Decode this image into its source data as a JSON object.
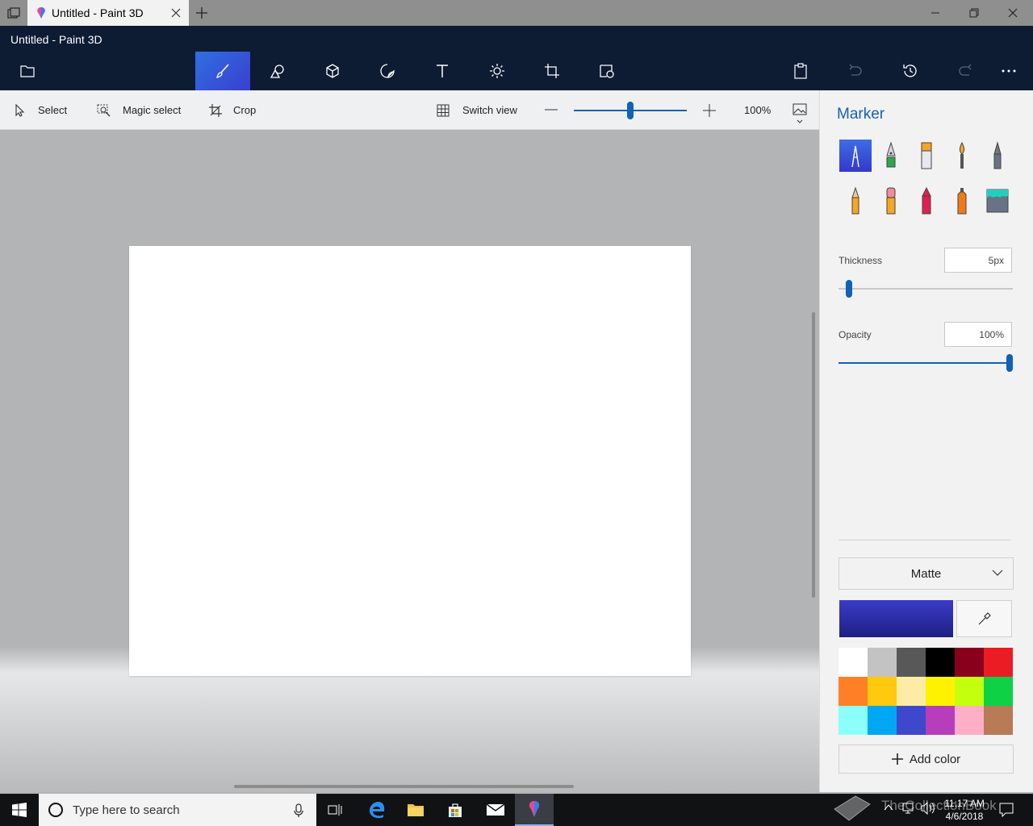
{
  "tab": {
    "title": "Untitled - Paint 3D"
  },
  "window": {
    "title": "Untitled - Paint 3D"
  },
  "appbar": {
    "tools": [
      "brushes-icon",
      "2d-shapes-icon",
      "3d-shapes-icon",
      "stickers-icon",
      "text-icon",
      "effects-icon",
      "canvas-icon",
      "3d-library-icon"
    ],
    "active_tool": "brushes-icon"
  },
  "toolbar": {
    "select": "Select",
    "magic_select": "Magic select",
    "crop": "Crop",
    "switch_view": "Switch view",
    "zoom": "100%",
    "zoom_level": 0.5
  },
  "panel": {
    "title": "Marker",
    "brushes": [
      "marker",
      "calligraphy-pen",
      "oil-brush",
      "watercolor",
      "pixel-pen",
      "pencil",
      "eraser",
      "crayon",
      "spray-can",
      "fill"
    ],
    "selected_brush": "marker",
    "thickness_label": "Thickness",
    "thickness_value": "5px",
    "thickness_level": 0.05,
    "opacity_label": "Opacity",
    "opacity_value": "100%",
    "opacity_level": 1.0,
    "finish": "Matte",
    "current_color": "#3a3cc8",
    "palette": [
      "#ffffff",
      "#c3c3c3",
      "#585858",
      "#000000",
      "#88001b",
      "#ec1c24",
      "#ff7f27",
      "#ffc90e",
      "#fdeca6",
      "#fff200",
      "#c4ff0e",
      "#0ed145",
      "#8cfffb",
      "#00a8f3",
      "#3f48cc",
      "#b83dba",
      "#ffaec8",
      "#b97a56"
    ],
    "add_color": "Add color"
  },
  "taskbar": {
    "search_placeholder": "Type here to search",
    "time": "11:17 AM",
    "date": "4/6/2018",
    "watermark": "TheCollectionBook"
  }
}
